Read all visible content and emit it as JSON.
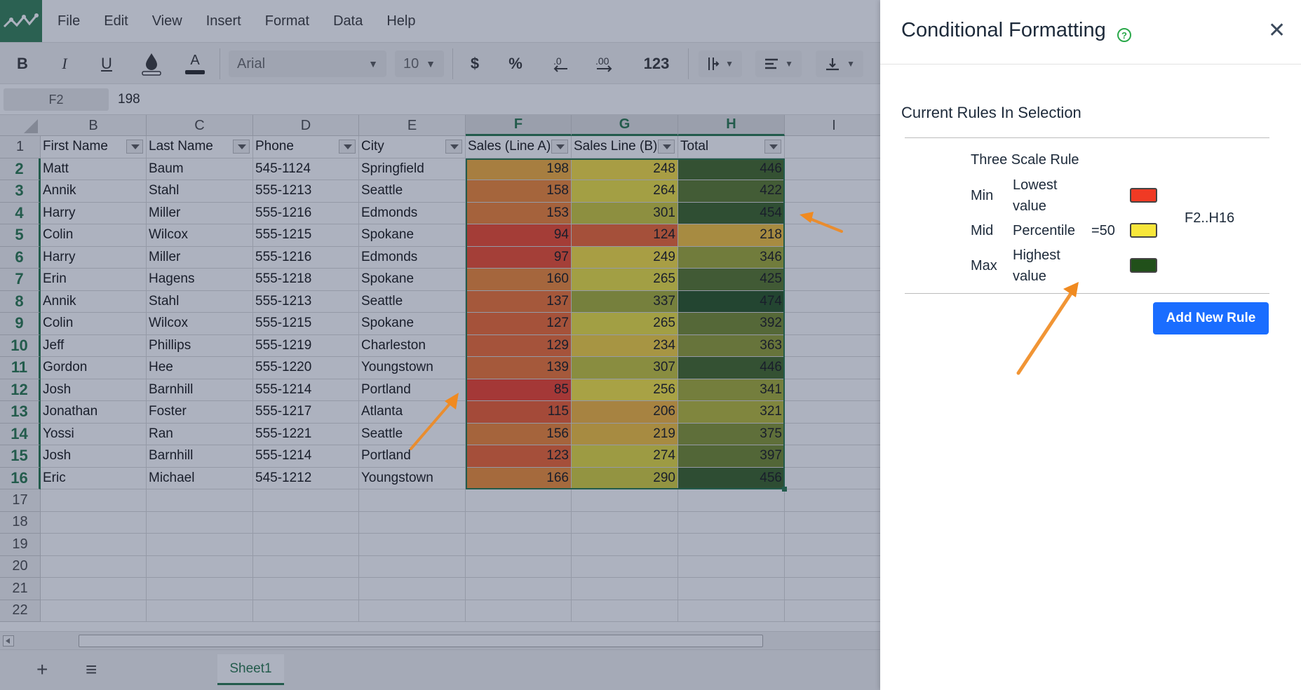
{
  "menu": [
    "File",
    "Edit",
    "View",
    "Insert",
    "Format",
    "Data",
    "Help"
  ],
  "toolbar": {
    "bold": "B",
    "italic": "I",
    "underline": "U",
    "text_color": "A",
    "font_name": "Arial",
    "font_size": "10",
    "currency": "$",
    "percent": "%",
    "number_format": "123"
  },
  "formula_bar": {
    "cell_ref": "F2",
    "value": "198"
  },
  "columns": [
    "B",
    "C",
    "D",
    "E",
    "F",
    "G",
    "H",
    "I"
  ],
  "row_numbers": [
    "1",
    "2",
    "3",
    "4",
    "5",
    "6",
    "7",
    "8",
    "9",
    "10",
    "11",
    "12",
    "13",
    "14",
    "15",
    "16",
    "17",
    "18",
    "19",
    "20",
    "21",
    "22"
  ],
  "headers": [
    "First Name",
    "Last Name",
    "Phone",
    "City",
    "Sales (Line A)",
    "Sales Line (B)",
    "Total"
  ],
  "rows": [
    [
      "Matt",
      "Baum",
      "545-1124",
      "Springfield",
      "198",
      "248",
      "446"
    ],
    [
      "Annik",
      "Stahl",
      "555-1213",
      "Seattle",
      "158",
      "264",
      "422"
    ],
    [
      "Harry",
      "Miller",
      "555-1216",
      "Edmonds",
      "153",
      "301",
      "454"
    ],
    [
      "Colin",
      "Wilcox",
      "555-1215",
      "Spokane",
      "94",
      "124",
      "218"
    ],
    [
      "Harry",
      "Miller",
      "555-1216",
      "Edmonds",
      "97",
      "249",
      "346"
    ],
    [
      "Erin",
      "Hagens",
      "555-1218",
      "Spokane",
      "160",
      "265",
      "425"
    ],
    [
      "Annik",
      "Stahl",
      "555-1213",
      "Seattle",
      "137",
      "337",
      "474"
    ],
    [
      "Colin",
      "Wilcox",
      "555-1215",
      "Spokane",
      "127",
      "265",
      "392"
    ],
    [
      "Jeff",
      "Phillips",
      "555-1219",
      "Charleston",
      "129",
      "234",
      "363"
    ],
    [
      "Gordon",
      "Hee",
      "555-1220",
      "Youngstown",
      "139",
      "307",
      "446"
    ],
    [
      "Josh",
      "Barnhill",
      "555-1214",
      "Portland",
      "85",
      "256",
      "341"
    ],
    [
      "Jonathan",
      "Foster",
      "555-1217",
      "Atlanta",
      "115",
      "206",
      "321"
    ],
    [
      "Yossi",
      "Ran",
      "555-1221",
      "Seattle",
      "156",
      "219",
      "375"
    ],
    [
      "Josh",
      "Barnhill",
      "555-1214",
      "Portland",
      "123",
      "274",
      "397"
    ],
    [
      "Eric",
      "Michael",
      "545-1212",
      "Youngstown",
      "166",
      "290",
      "456"
    ]
  ],
  "sheet_tab": "Sheet1",
  "dialog": {
    "title": "Conditional Formatting",
    "help_icon": "?",
    "close": "✕",
    "section": "Current Rules In Selection",
    "rule_name": "Three Scale Rule",
    "rules": [
      {
        "label": "Min",
        "type": "Lowest value",
        "value": "",
        "color": "#f03a24"
      },
      {
        "label": "Mid",
        "type": "Percentile",
        "value": "=50",
        "color": "#f7e63a"
      },
      {
        "label": "Max",
        "type": "Highest value",
        "value": "",
        "color": "#21501a"
      }
    ],
    "range": "F2..H16",
    "add_button": "Add New Rule"
  }
}
